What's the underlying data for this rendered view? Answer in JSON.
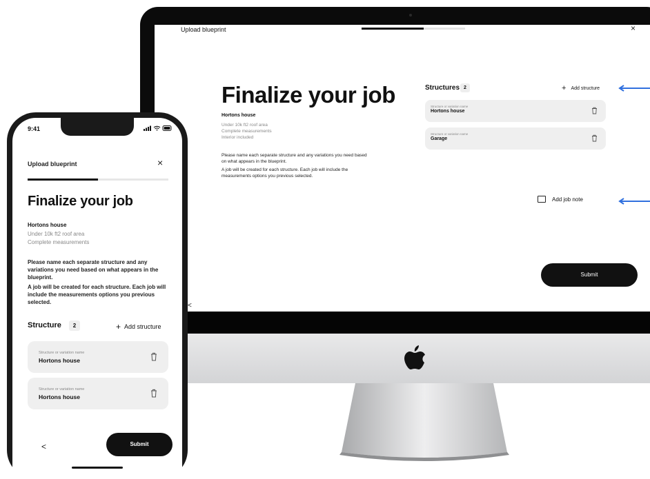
{
  "desktop": {
    "topbar": {
      "title": "Upload blueprint",
      "progress": 0.6
    },
    "heading": "Finalize your job",
    "job": {
      "name": "Hortons house",
      "details": [
        "Under 10k ft2 roof area",
        "Complete measurements",
        "Interior included"
      ]
    },
    "paragraphs": [
      "Please name each separate structure and any variations you need based on what appears in the blueprint.",
      "A job will be created for each structure. Each job will include the measurements options you previous selected."
    ],
    "structures": {
      "heading": "Structures",
      "count": "2",
      "add_label": "Add structure",
      "items": [
        {
          "label": "Structure or variation name",
          "value": "Hortons house"
        },
        {
          "label": "Structure or variation name",
          "value": "Garage"
        }
      ]
    },
    "note_label": "Add job note",
    "submit_label": "Submit",
    "back_icon": "<",
    "close_icon": "×"
  },
  "mobile": {
    "status": {
      "time": "9:41"
    },
    "topbar": {
      "title": "Upload blueprint",
      "progress": 0.5
    },
    "heading": "Finalize your job",
    "job": {
      "name": "Hortons house",
      "details": [
        "Under 10k ft2 roof area",
        "Complete measurements"
      ]
    },
    "paragraphs": [
      "Please name each separate structure and any variations you need based on what appears in the blueprint.",
      "A job will be created for each structure. Each job will include the measurements options you previous selected."
    ],
    "structures": {
      "heading": "Structure",
      "count": "2",
      "add_label": "Add structure",
      "items": [
        {
          "label": "Structure or variation name",
          "value": "Hortons house"
        },
        {
          "label": "Structure or variation name",
          "value": "Hortons house"
        }
      ]
    },
    "submit_label": "Submit",
    "back_icon": "<",
    "close_icon": "×"
  },
  "colors": {
    "accent": "#2f6fde",
    "dark": "#111111",
    "card": "#efefef"
  }
}
